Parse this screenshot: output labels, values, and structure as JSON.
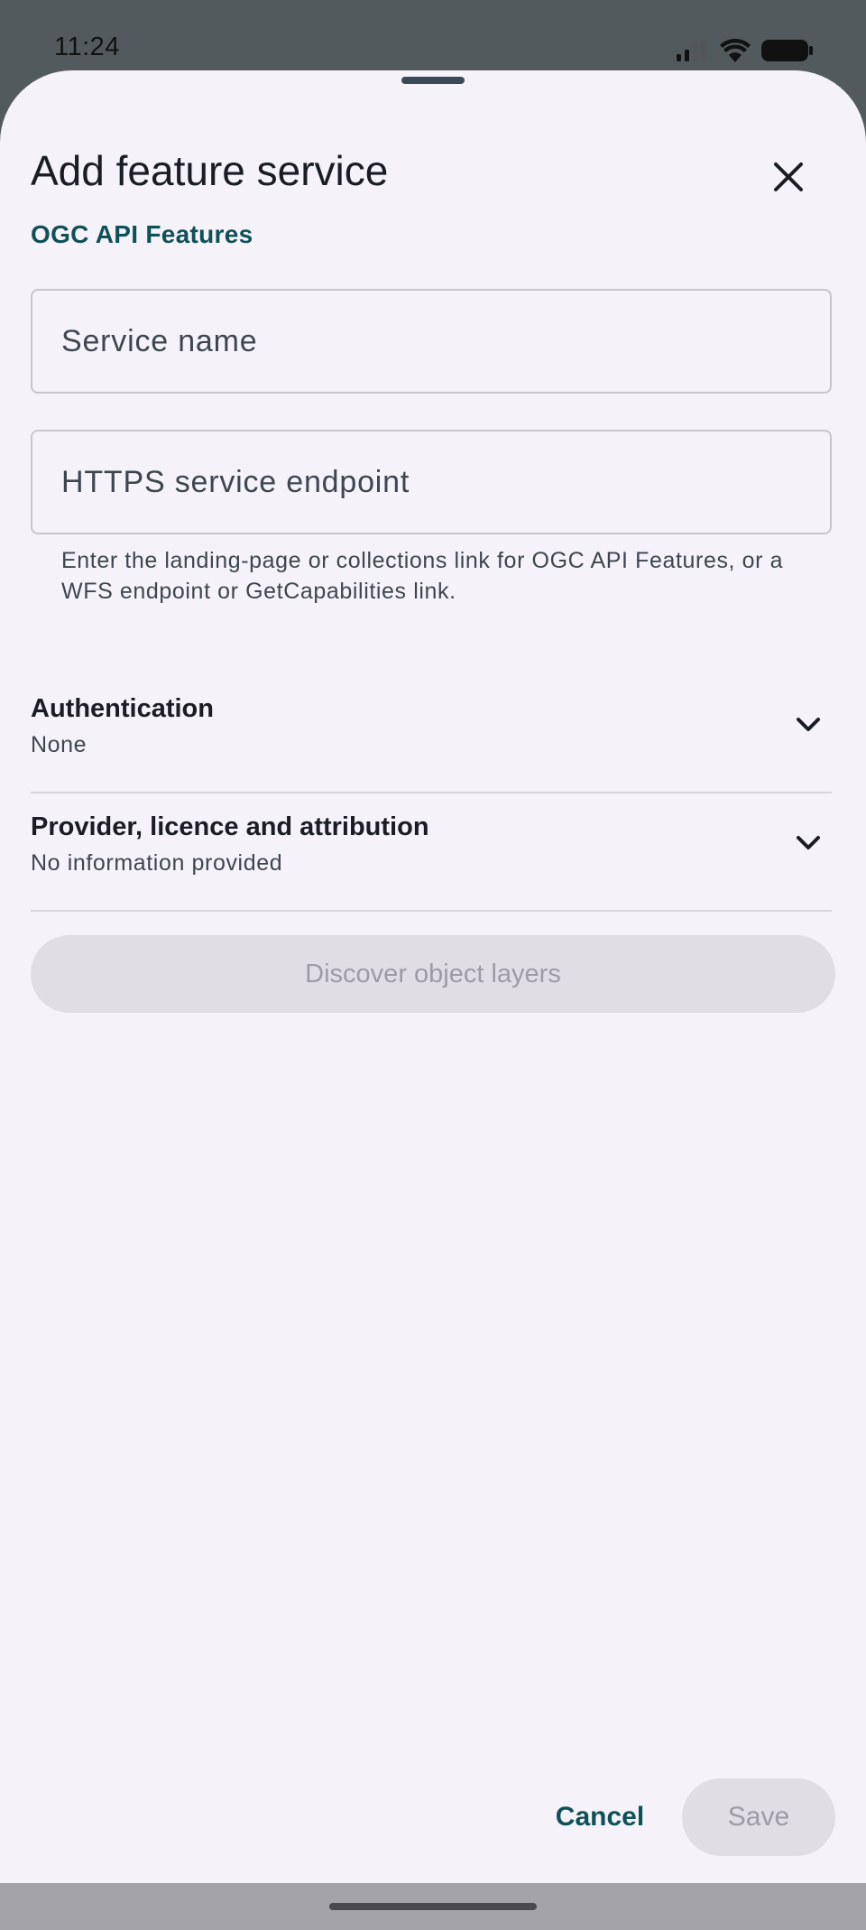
{
  "status_bar": {
    "time": "11:24",
    "icons": [
      "signal-icon",
      "wifi-icon",
      "battery-icon"
    ]
  },
  "sheet": {
    "title": "Add feature service",
    "subtitle": "OGC API Features"
  },
  "form": {
    "service_name_placeholder": "Service name",
    "endpoint_placeholder": "HTTPS service endpoint",
    "endpoint_helper": "Enter the landing-page or collections link for OGC API Features, or a WFS endpoint or GetCapabilities link."
  },
  "authentication": {
    "title": "Authentication",
    "value": "None"
  },
  "provider": {
    "title": "Provider, licence and attribution",
    "value": "No information provided"
  },
  "buttons": {
    "discover": "Discover object layers",
    "cancel": "Cancel",
    "save": "Save"
  },
  "colors": {
    "accent": "#0f5158",
    "sheet_background": "#f6f2f9",
    "disabled_button": "#e0dde5",
    "disabled_text": "#9e9aa6"
  }
}
